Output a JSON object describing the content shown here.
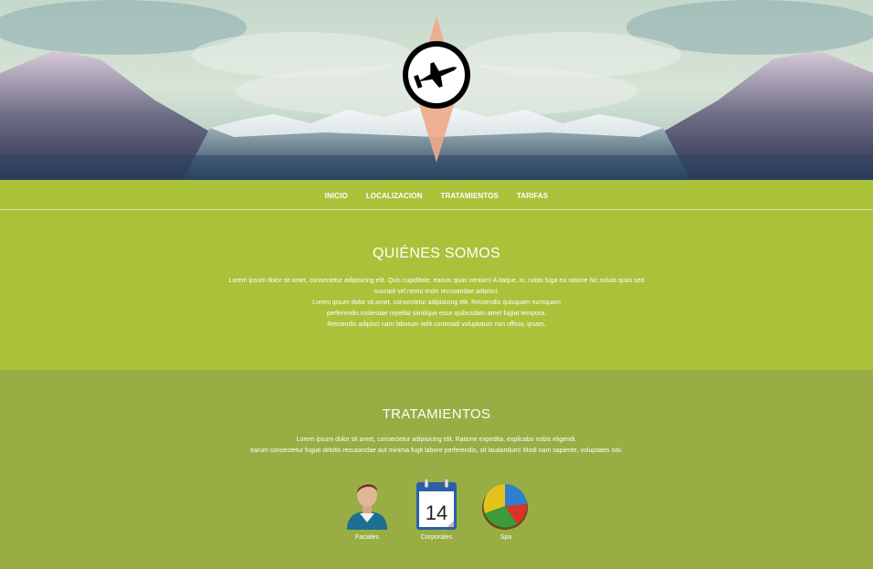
{
  "hero": {
    "logo_icon": "jet-fighter-icon"
  },
  "nav": {
    "items": [
      "INICIO",
      "LOCALIZACION",
      "TRATAMIENTOS",
      "TARIFAS"
    ]
  },
  "about": {
    "title": "QUIÉNES SOMOS",
    "lines": [
      "Lorem ipsum dolor sit amet, consectetur adipisicing elit. Quis cupiditate, earum quas veniam! A itaque, in, nobis fuga ea ratione hic soluta quas sed",
      "suscipit vel nemo enim recusandae adipisci.",
      "Lorem ipsum dolor sit amet, consectetur adipisicing elit. Reiciendis quisquam numquam",
      "perferendis molestiae repellat similique esse quibusdam amet fugiat tempora.",
      "Reiciendis adipisci nam laborum velit commodi voluptatum non officia, ipsam."
    ]
  },
  "treatments": {
    "title": "TRATAMIENTOS",
    "lines": [
      "Lorem ipsum dolor sit amet, consectetur adipisicing elit. Ratione expedita, explicabo nobis eligendi,",
      "earum consectetur fugiat debitis recusandae aut minima fugit labore perferendis, sit laudantium! Modi nam sapiente, voluptates nisi."
    ],
    "services": [
      {
        "label": "Faciales",
        "icon": "user-icon"
      },
      {
        "label": "Corporales",
        "icon": "calendar-icon",
        "calendar_day": "14"
      },
      {
        "label": "Spa",
        "icon": "pie-chart-icon"
      }
    ]
  },
  "colors": {
    "primary_green": "#a9c23a",
    "secondary_green": "#98ad44",
    "logo_accent": "#f0a988"
  }
}
